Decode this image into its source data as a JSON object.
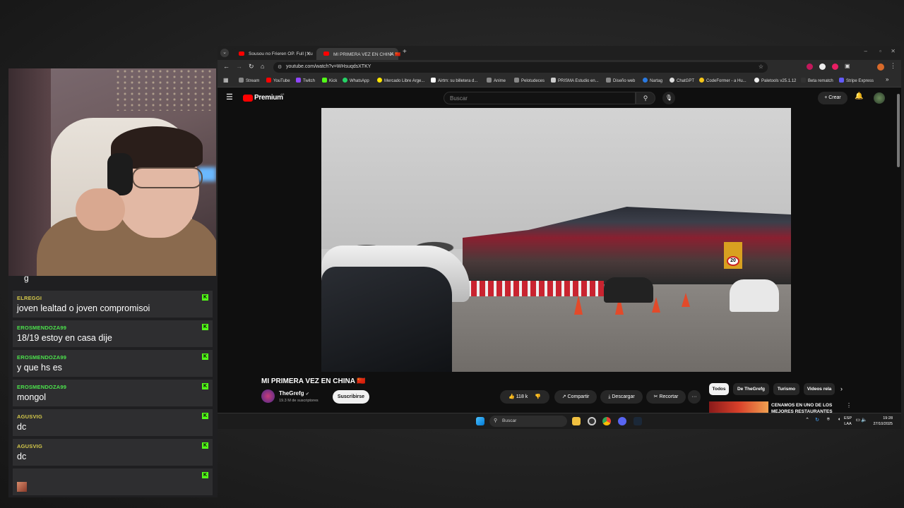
{
  "browser": {
    "tabs": [
      {
        "title": "Sousou no Frieren OP. Full | Yu"
      },
      {
        "title": "MI PRIMERA VEZ EN CHINA 🇨🇳"
      }
    ],
    "new_tab": "+",
    "url": "youtube.com/watch?v=WHsuqdsXTKY",
    "bookmarks": [
      "Stream",
      "YouTube",
      "Twitch",
      "Kick",
      "WhatsApp",
      "Mercado Libre Arge...",
      "Airtm: su billetera d...",
      "Anime",
      "Pelotudeces",
      "PRISMA Estudio en...",
      "Diseño web",
      "Nartag",
      "ChatGPT",
      "CodeFormer - a Hu...",
      "Paletools v25.1.12",
      "Beta rematch",
      "Stripe Express"
    ],
    "more_bookmarks": "»"
  },
  "youtube": {
    "logo": "Premium",
    "logo_sup": "AR",
    "search_placeholder": "Buscar",
    "create_label": "+ Crear",
    "video_title": "MI PRIMERA VEZ EN CHINA 🇨🇳",
    "channel": "TheGrefg",
    "subscribers": "19.3 M de suscriptores",
    "subscribe": "Suscribirse",
    "likes": "118 k",
    "share": "Compartir",
    "download": "Descargar",
    "clip": "Recortar",
    "more": "···",
    "chips": [
      "Todos",
      "De TheGrefg",
      "Turismo",
      "Videos rela"
    ],
    "recommended_title": "CENAMOS EN UNO DE LOS MEJORES RESTAURANTES",
    "video_sign": "20"
  },
  "chat": {
    "partial_line": "g",
    "messages": [
      {
        "user": "ELREGGI",
        "text": "joven lealtad o joven compromisoi",
        "color": "#d4c84a"
      },
      {
        "user": "EROSMENDOZA99",
        "text": "18/19 estoy en casa dije",
        "color": "#4ce34c"
      },
      {
        "user": "EROSMENDOZA99",
        "text": "y que hs es",
        "color": "#4ce34c"
      },
      {
        "user": "EROSMENDOZA99",
        "text": "mongol",
        "color": "#4ce34c"
      },
      {
        "user": "AGUSVIG",
        "text": "dc",
        "color": "#d4c84a"
      },
      {
        "user": "AGUSVIG",
        "text": "dc",
        "color": "#d4c84a"
      },
      {
        "user": "",
        "text": "",
        "color": "#d6293b"
      }
    ],
    "kick_badge": "K"
  },
  "taskbar": {
    "search_placeholder": "Buscar",
    "lang": "ESP",
    "lang2": "LAA",
    "time": "19:28",
    "date": "27/10/2025"
  }
}
